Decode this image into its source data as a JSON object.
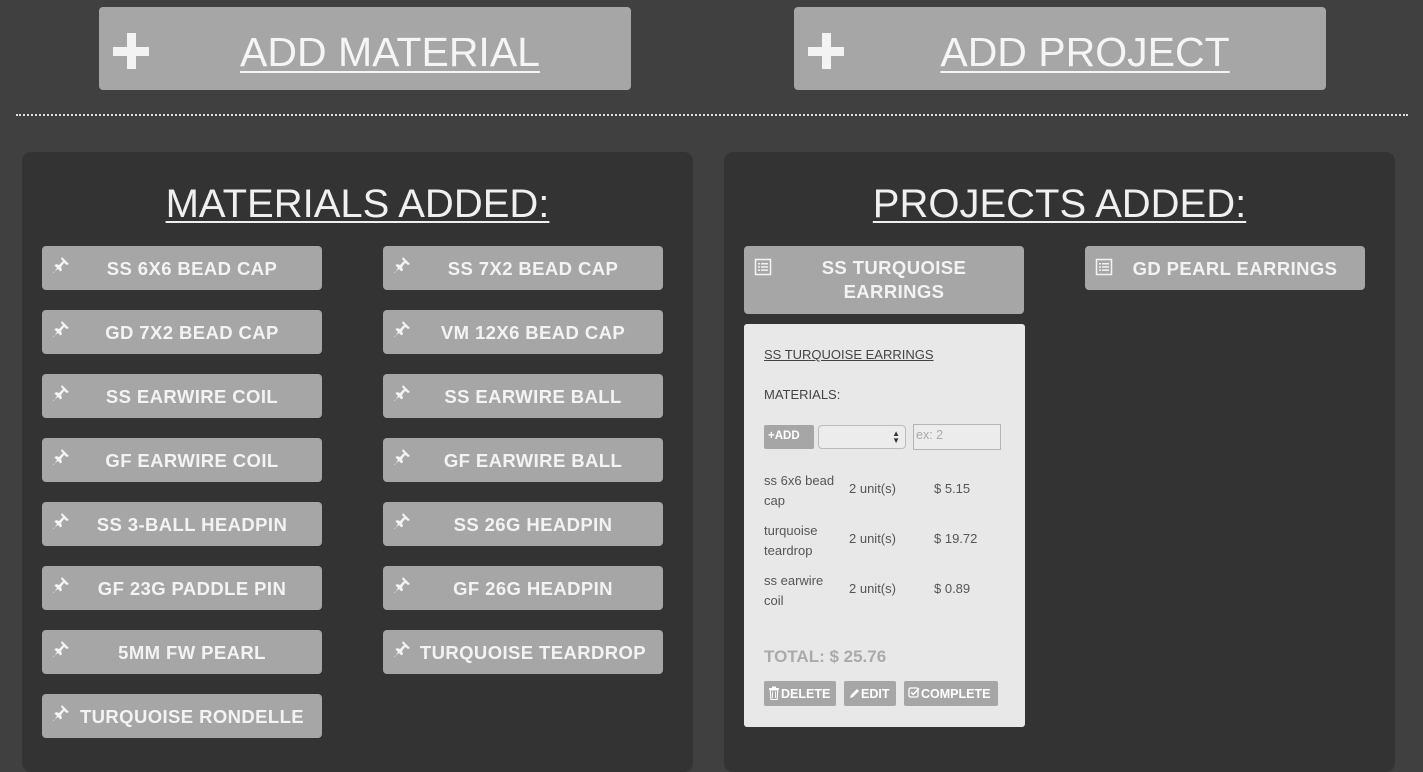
{
  "top_buttons": {
    "add_material": "ADD MATERIAL",
    "add_project": "ADD PROJECT"
  },
  "materials": {
    "title": "MATERIALS ADDED:",
    "items": [
      "SS 6X6 BEAD CAP",
      "SS 7X2 BEAD CAP",
      "GD 7X2 BEAD CAP",
      "VM 12X6 BEAD CAP",
      "SS EARWIRE COIL",
      "SS EARWIRE BALL",
      "GF EARWIRE COIL",
      "GF EARWIRE BALL",
      "SS 3-BALL HEADPIN",
      "SS 26G HEADPIN",
      "GF 23G PADDLE PIN",
      "GF 26G HEADPIN",
      "5MM FW PEARL",
      "TURQUOISE TEARDROP",
      "TURQUOISE RONDELLE"
    ]
  },
  "projects": {
    "title": "PROJECTS ADDED:",
    "items": [
      "SS TURQUOISE EARRINGS",
      "GD PEARL EARRINGS"
    ],
    "card": {
      "title": "SS TURQUOISE EARRINGS",
      "materials_label": "MATERIALS:",
      "add_label": "ADD",
      "select_value": "",
      "qty_placeholder": "ex: 2",
      "rows": [
        {
          "name": "ss 6x6 bead cap",
          "units": "2 unit(s)",
          "price": "$ 5.15"
        },
        {
          "name": "turquoise teardrop",
          "units": "2 unit(s)",
          "price": "$ 19.72"
        },
        {
          "name": "ss earwire coil",
          "units": "2 unit(s)",
          "price": "$ 0.89"
        }
      ],
      "total": "TOTAL: $ 25.76",
      "buttons": {
        "delete": "DELETE",
        "edit": "EDIT",
        "complete": "COMPLETE"
      }
    }
  },
  "colors": {
    "page_bg": "#404040",
    "panel_bg": "#333333",
    "button_bg": "#a6a6a6",
    "card_bg": "#e8e8e8"
  },
  "icons": {
    "add": "plus-icon",
    "material": "pin-icon",
    "project": "list-document-icon",
    "delete": "trash-icon",
    "edit": "pencil-icon",
    "complete": "check-square-icon"
  }
}
